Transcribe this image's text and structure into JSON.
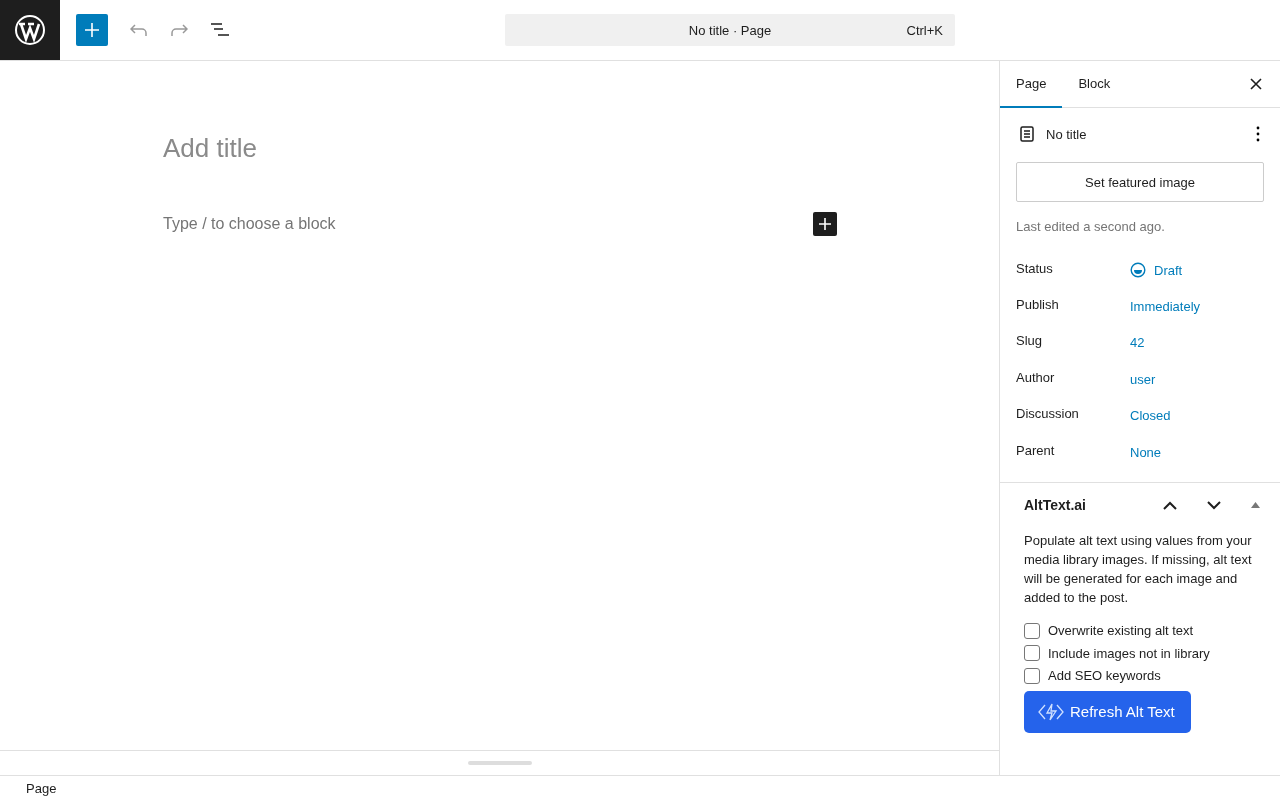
{
  "toolbar": {
    "command_bar": {
      "title": "No title · Page",
      "shortcut": "Ctrl+K"
    }
  },
  "editor": {
    "title_placeholder": "Add title",
    "block_placeholder": "Type / to choose a block"
  },
  "sidebar": {
    "tabs": [
      {
        "label": "Page",
        "selected": true
      },
      {
        "label": "Block",
        "selected": false
      }
    ],
    "summary": {
      "title": "No title",
      "featured_button": "Set featured image",
      "last_edited": "Last edited a second ago.",
      "fields": [
        {
          "label": "Status",
          "value": "Draft",
          "kind": "status"
        },
        {
          "label": "Publish",
          "value": "Immediately",
          "kind": "link"
        },
        {
          "label": "Slug",
          "value": "42",
          "kind": "link"
        },
        {
          "label": "Author",
          "value": "user",
          "kind": "link"
        },
        {
          "label": "Discussion",
          "value": "Closed",
          "kind": "link"
        },
        {
          "label": "Parent",
          "value": "None",
          "kind": "link"
        }
      ]
    },
    "panel": {
      "title": "AltText.ai",
      "expanded": true,
      "description": "Populate alt text using values from your media library images. If missing, alt text will be generated for each image and added to the post.",
      "options": [
        {
          "label": "Overwrite existing alt text",
          "checked": false
        },
        {
          "label": "Include images not in library",
          "checked": false
        },
        {
          "label": "Add SEO keywords",
          "checked": false
        }
      ],
      "button": "Refresh Alt Text"
    }
  },
  "footer": {
    "breadcrumb": "Page"
  }
}
